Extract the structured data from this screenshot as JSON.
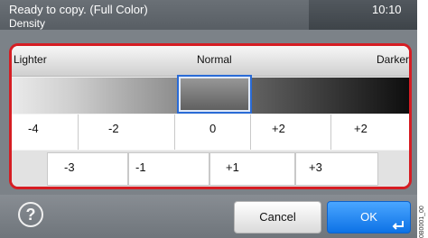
{
  "status": {
    "text": "Ready to copy. (Full Color)",
    "time": "10:10"
  },
  "screen": {
    "subtitle": "Density"
  },
  "density": {
    "label_lighter": "Lighter",
    "label_normal": "Normal",
    "label_darker": "Darker",
    "selected_value": "0",
    "row1": [
      "-4",
      "-2",
      "0",
      "+2",
      "+2"
    ],
    "row2": [
      "-3",
      "-1",
      "+1",
      "+3"
    ]
  },
  "buttons": {
    "cancel": "Cancel",
    "ok": "OK"
  },
  "icons": {
    "help": "question-mark-icon",
    "enter": "enter-arrow-icon"
  },
  "side_code": "0B0001_00",
  "colors": {
    "highlight": "#d61d23",
    "selected": "#2a6bd6",
    "ok": "#0d72e6"
  }
}
